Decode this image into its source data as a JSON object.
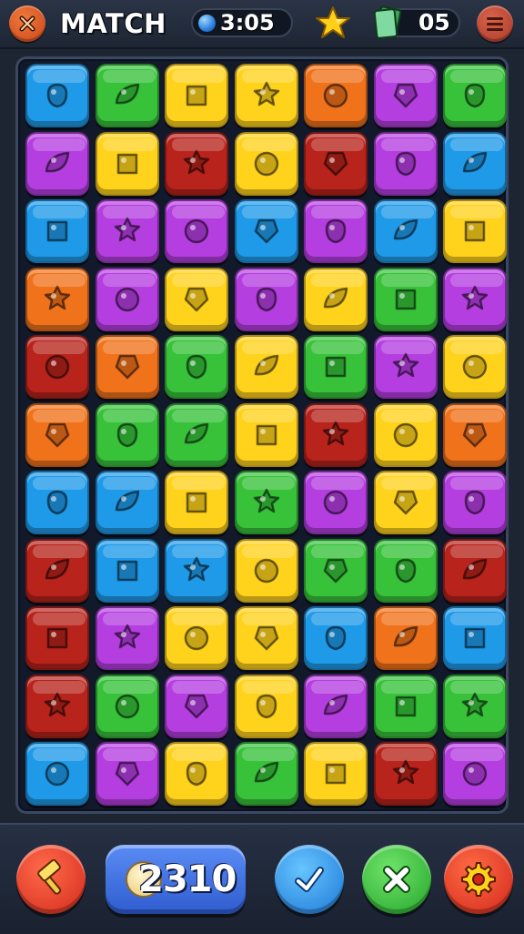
{
  "header": {
    "title": "MATCH",
    "timer": "3:05",
    "moves": "05",
    "icons": {
      "close": "close-x-icon",
      "timer": "blue-gem-icon",
      "star": "star-icon",
      "moves": "card-icon",
      "menu": "menu-icon"
    }
  },
  "board": {
    "columns": 7,
    "rows": 11,
    "tiles": [
      [
        "blue",
        "green",
        "yellow",
        "yellow",
        "orange",
        "purple",
        "green"
      ],
      [
        "purple",
        "yellow",
        "red",
        "yellow",
        "red",
        "purple",
        "blue"
      ],
      [
        "blue",
        "purple",
        "purple",
        "blue",
        "purple",
        "blue",
        "yellow"
      ],
      [
        "orange",
        "purple",
        "yellow",
        "purple",
        "yellow",
        "green",
        "purple"
      ],
      [
        "red",
        "orange",
        "green",
        "yellow",
        "green",
        "purple",
        "yellow"
      ],
      [
        "orange",
        "green",
        "green",
        "yellow",
        "red",
        "yellow",
        "orange"
      ],
      [
        "blue",
        "blue",
        "yellow",
        "green",
        "purple",
        "yellow",
        "purple"
      ],
      [
        "red",
        "blue",
        "blue",
        "yellow",
        "green",
        "green",
        "red"
      ],
      [
        "red",
        "purple",
        "yellow",
        "yellow",
        "blue",
        "orange",
        "blue"
      ],
      [
        "red",
        "green",
        "purple",
        "yellow",
        "purple",
        "green",
        "green"
      ],
      [
        "blue",
        "purple",
        "yellow",
        "green",
        "yellow",
        "red",
        "purple"
      ]
    ],
    "colors": {
      "red": "#b8231c",
      "orange": "#f0721a",
      "yellow": "#ffd21c",
      "green": "#37c23a",
      "blue": "#1f9ae8",
      "purple": "#b53ee0"
    }
  },
  "footer": {
    "score": "2310",
    "icons": {
      "hammer": "hammer-icon",
      "check": "check-icon",
      "close": "close-icon",
      "settings": "gear-icon"
    }
  }
}
